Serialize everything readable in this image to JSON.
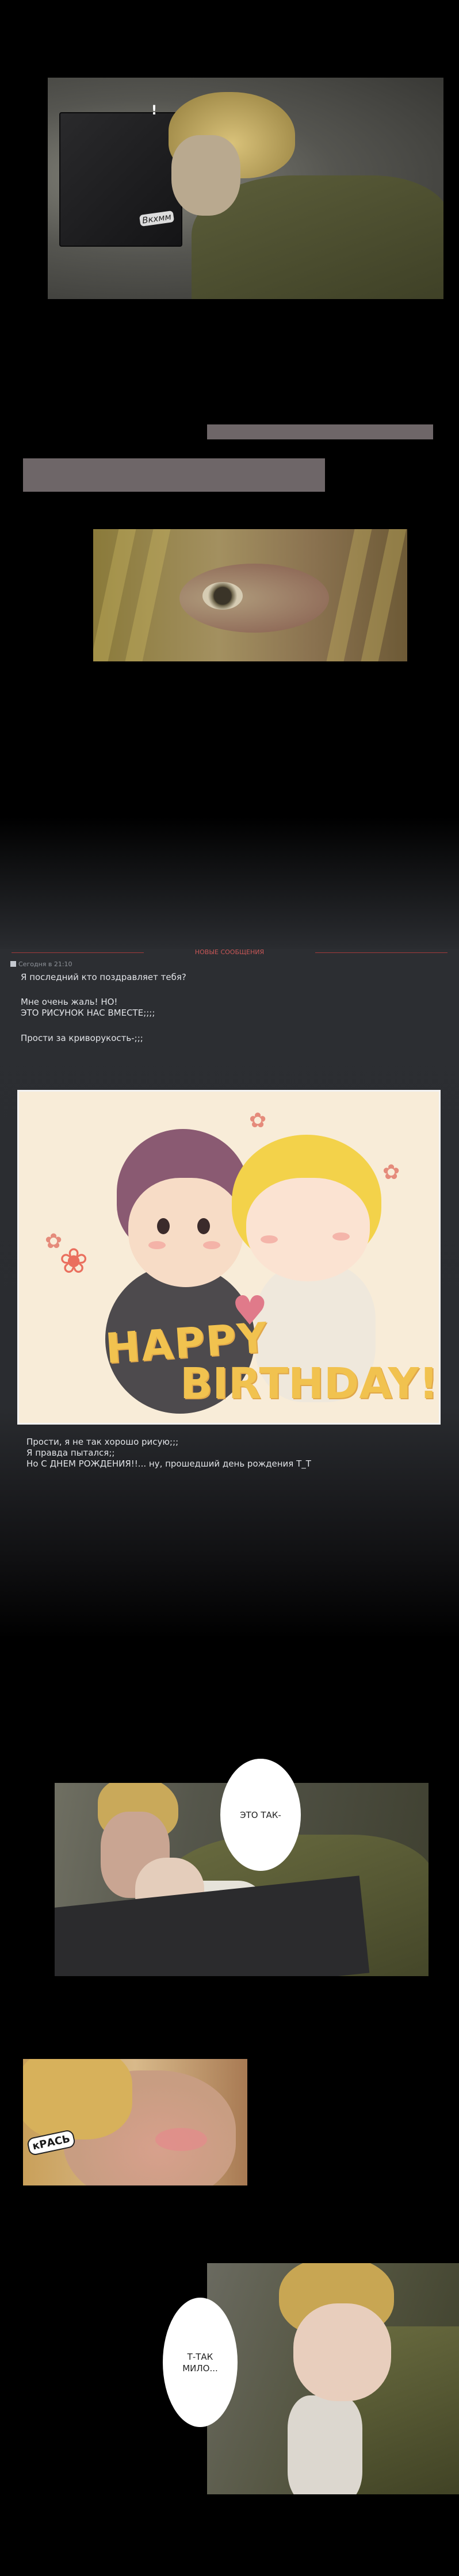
{
  "panel1": {
    "sfx": "Вкхмм"
  },
  "comment_section": {
    "header_title": "НОВЫЕ СООБЩЕНИЯ",
    "timestamp": "Сегодня в 21:10",
    "message_lines_1": "Я последний кто поздравляет тебя?",
    "message_lines_2": "Мне очень жаль! НО!\nЭТО РИСУНОК НАС ВМЕСТЕ;;;;",
    "message_lines_3": "Прости за криворукость-;;;",
    "message_lines_4": "Прости, я не так хорошо рисую;;;\nЯ правда пытался;;\nНо С ДНЕМ РОЖДЕНИЯ!!... ну, прошедший день рождения T_T"
  },
  "artwork": {
    "happy": "HAPPY",
    "birthday": "BIRTHDAY!"
  },
  "bubble1": "ЭТО ТАК-",
  "panel4": {
    "sfx": "кРАСЬ"
  },
  "bubble2": "Т-ТАК\nМИЛО..."
}
